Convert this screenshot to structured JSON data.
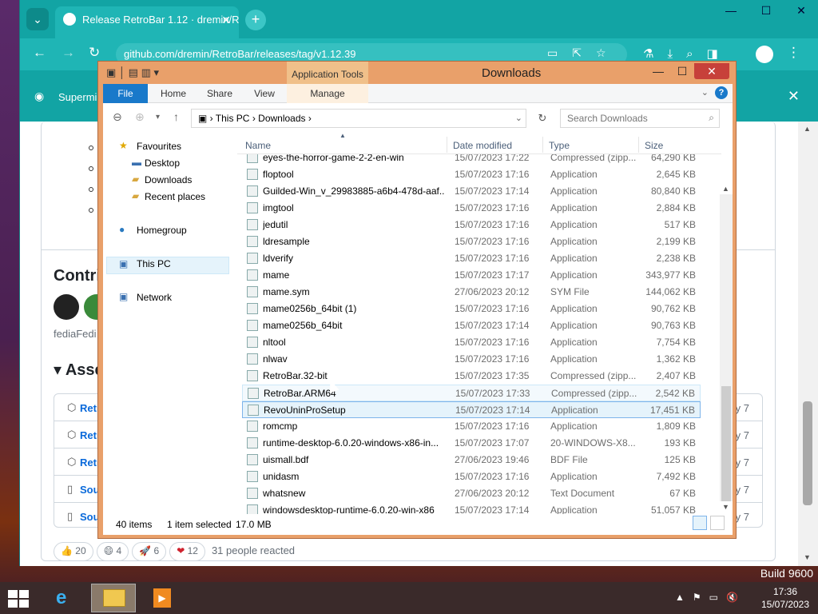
{
  "browser": {
    "tab_title": "Release RetroBar 1.12 · dremin/R",
    "url": "github.com/dremin/RetroBar/releases/tag/v1.12.39",
    "banner_text": "Supermin",
    "accent": "#12a4a4"
  },
  "page": {
    "contributors_heading": "Contri",
    "contributor_text": "fediaFedi",
    "assets_heading": "Asse",
    "asset_rows": [
      {
        "name": "Retro",
        "date": "y 7"
      },
      {
        "name": "Retro",
        "date": "y 7"
      },
      {
        "name": "Retro",
        "date": "y 7"
      },
      {
        "name": "Sou",
        "date": "y 7"
      },
      {
        "name": "Sou",
        "date": "y 7"
      }
    ],
    "reactions": [
      {
        "emoji": "👍",
        "count": "20"
      },
      {
        "emoji": "😄",
        "count": "4"
      },
      {
        "emoji": "🚀",
        "count": "6"
      },
      {
        "emoji": "❤",
        "count": "12"
      }
    ],
    "reacted_text": "31 people reacted"
  },
  "explorer": {
    "title": "Downloads",
    "app_tools": "Application Tools",
    "ribbon_tabs": [
      "File",
      "Home",
      "Share",
      "View",
      "Manage"
    ],
    "breadcrumb": [
      "This PC",
      "Downloads"
    ],
    "search_placeholder": "Search Downloads",
    "nav": {
      "favourites": "Favourites",
      "desktop": "Desktop",
      "downloads": "Downloads",
      "recent": "Recent places",
      "homegroup": "Homegroup",
      "thispc": "This PC",
      "network": "Network"
    },
    "columns": {
      "name": "Name",
      "date": "Date modified",
      "type": "Type",
      "size": "Size"
    },
    "files": [
      {
        "name": "eyes-the-horror-game-2-2-en-win",
        "date": "15/07/2023 17:22",
        "type": "Compressed (zipp...",
        "size": "64,290 KB"
      },
      {
        "name": "floptool",
        "date": "15/07/2023 17:16",
        "type": "Application",
        "size": "2,645 KB"
      },
      {
        "name": "Guilded-Win_v_29983885-a6b4-478d-aaf...",
        "date": "15/07/2023 17:14",
        "type": "Application",
        "size": "80,840 KB"
      },
      {
        "name": "imgtool",
        "date": "15/07/2023 17:16",
        "type": "Application",
        "size": "2,884 KB"
      },
      {
        "name": "jedutil",
        "date": "15/07/2023 17:16",
        "type": "Application",
        "size": "517 KB"
      },
      {
        "name": "ldresample",
        "date": "15/07/2023 17:16",
        "type": "Application",
        "size": "2,199 KB"
      },
      {
        "name": "ldverify",
        "date": "15/07/2023 17:16",
        "type": "Application",
        "size": "2,238 KB"
      },
      {
        "name": "mame",
        "date": "15/07/2023 17:17",
        "type": "Application",
        "size": "343,977 KB"
      },
      {
        "name": "mame.sym",
        "date": "27/06/2023 20:12",
        "type": "SYM File",
        "size": "144,062 KB"
      },
      {
        "name": "mame0256b_64bit (1)",
        "date": "15/07/2023 17:16",
        "type": "Application",
        "size": "90,762 KB"
      },
      {
        "name": "mame0256b_64bit",
        "date": "15/07/2023 17:14",
        "type": "Application",
        "size": "90,763 KB"
      },
      {
        "name": "nltool",
        "date": "15/07/2023 17:16",
        "type": "Application",
        "size": "7,754 KB"
      },
      {
        "name": "nlwav",
        "date": "15/07/2023 17:16",
        "type": "Application",
        "size": "1,362 KB"
      },
      {
        "name": "RetroBar.32-bit",
        "date": "15/07/2023 17:35",
        "type": "Compressed (zipp...",
        "size": "2,407 KB"
      },
      {
        "name": "RetroBar.ARM64",
        "date": "15/07/2023 17:33",
        "type": "Compressed (zipp...",
        "size": "2,542 KB"
      },
      {
        "name": "RevoUninProSetup",
        "date": "15/07/2023 17:14",
        "type": "Application",
        "size": "17,451 KB"
      },
      {
        "name": "romcmp",
        "date": "15/07/2023 17:16",
        "type": "Application",
        "size": "1,809 KB"
      },
      {
        "name": "runtime-desktop-6.0.20-windows-x86-in...",
        "date": "15/07/2023 17:07",
        "type": "20-WINDOWS-X8...",
        "size": "193 KB"
      },
      {
        "name": "uismall.bdf",
        "date": "27/06/2023 19:46",
        "type": "BDF File",
        "size": "125 KB"
      },
      {
        "name": "unidasm",
        "date": "15/07/2023 17:16",
        "type": "Application",
        "size": "7,492 KB"
      },
      {
        "name": "whatsnew",
        "date": "27/06/2023 20:12",
        "type": "Text Document",
        "size": "67 KB"
      },
      {
        "name": "windowsdesktop-runtime-6.0.20-win-x86",
        "date": "15/07/2023 17:14",
        "type": "Application",
        "size": "51,057 KB"
      }
    ],
    "status_items": "40 items",
    "status_selected": "1 item selected",
    "status_size": "17.0 MB"
  },
  "taskbar": {
    "build": "Build 9600",
    "time": "17:36",
    "date": "15/07/2023"
  }
}
